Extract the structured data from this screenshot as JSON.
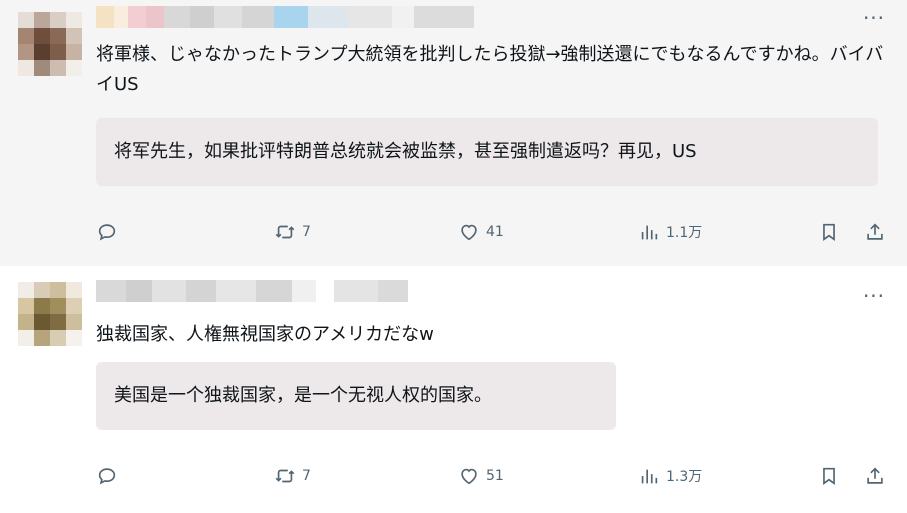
{
  "posts": [
    {
      "text": "将軍様、じゃなかったトランプ大統領を批判したら投獄→強制送還にでもなるんですかね。バイバイUS",
      "translation": "将军先生，如果批评特朗普总统就会被监禁，甚至强制遣返吗？再见，US",
      "more_label": "···",
      "retweets": "7",
      "likes": "41",
      "views": "1.1万"
    },
    {
      "text": "独裁国家、人権無視国家のアメリカだなw",
      "translation": "美国是一个独裁国家，是一个无视人权的国家。",
      "more_label": "···",
      "retweets": "7",
      "likes": "51",
      "views": "1.3万"
    }
  ],
  "icons": {
    "reply": "reply-icon",
    "retweet": "retweet-icon",
    "like": "heart-icon",
    "views": "views-icon",
    "bookmark": "bookmark-icon",
    "share": "share-icon"
  },
  "colors": {
    "icon": "#536471",
    "post_highlight_bg": "#f5f5f5",
    "translation_bg": "#ede8e9"
  }
}
